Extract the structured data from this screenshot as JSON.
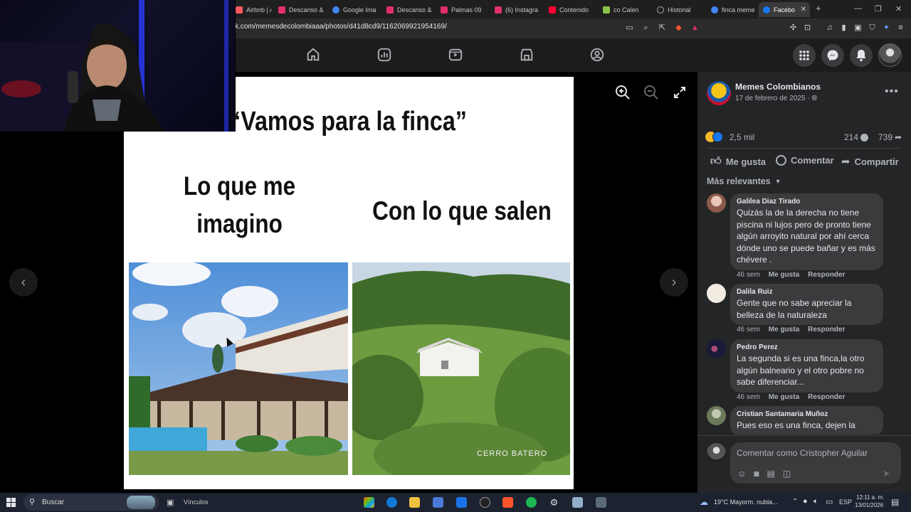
{
  "browser": {
    "tabs": [
      {
        "label": "Airbnb | Ale",
        "color": "#ff5a5f"
      },
      {
        "label": "Descanso &",
        "color": "#e1306c"
      },
      {
        "label": "Google Ima",
        "color": "#4285f4"
      },
      {
        "label": "Descanso &",
        "color": "#e1306c"
      },
      {
        "label": "Palmas 09",
        "color": "#e1306c"
      },
      {
        "label": "(6) Instagra",
        "color": "#e1306c"
      },
      {
        "label": "Contenido",
        "color": "#ff0033"
      },
      {
        "label": "co Calen",
        "color": "#8bc34a"
      },
      {
        "label": "Historial",
        "color": "#9e9e9e"
      },
      {
        "label": "finca meme",
        "color": "#4285f4"
      },
      {
        "label": "Facebo",
        "color": "#1877f2"
      }
    ],
    "url": "k.com/memesdecolombiaaa/photos/d41d8cd9/1162069921954169/"
  },
  "post": {
    "page_name": "Memes Colombianos",
    "date": "17 de febrero de 2025 · ",
    "reactions_count": "2,5 mil",
    "comments_count": "214",
    "shares_count": "739",
    "like_label": "Me gusta",
    "comment_label": "Comentar",
    "share_label": "Compartir",
    "sort_label": "Más relevantes"
  },
  "meme": {
    "title": "“Vamos para la finca”",
    "left_line1": "Lo que me",
    "left_line2": "imagino",
    "right_caption": "Con lo que salen",
    "watermark": "CERRO BATERO"
  },
  "comments": [
    {
      "name": "Galilea Diaz Tirado",
      "text": "Quizás la de la derecha no tiene piscina ni lujos pero de pronto tiene algún arroyito natural por ahí cerca dónde uno se puede bañar y es más chévere .",
      "time": "46 sem",
      "like": "Me gusta",
      "reply": "Responder"
    },
    {
      "name": "Dalila Ruiz",
      "text": "Gente que no sabe apreciar la belleza de la naturaleza",
      "time": "46 sem",
      "like": "Me gusta",
      "reply": "Responder"
    },
    {
      "name": "Pedro Perez",
      "text": "La segunda si es una finca,la otro algún balneario y el otro pobre no sabe diferenciar...",
      "time": "46 sem",
      "like": "Me gusta",
      "reply": "Responder"
    },
    {
      "name": "Cristian Santamaria Muñoz",
      "text": "Pues eso es una finca, dejen la",
      "time": "",
      "like": "",
      "reply": ""
    }
  ],
  "composer": {
    "placeholder": "Comentar como Cristopher Aguilar"
  },
  "taskbar": {
    "search": "Buscar",
    "vinculos": "Vínculos",
    "weather": "19°C  Mayorm. nubla...",
    "lang": "ESP",
    "time": "12:11 a. m.",
    "date": "13/01/2026"
  }
}
